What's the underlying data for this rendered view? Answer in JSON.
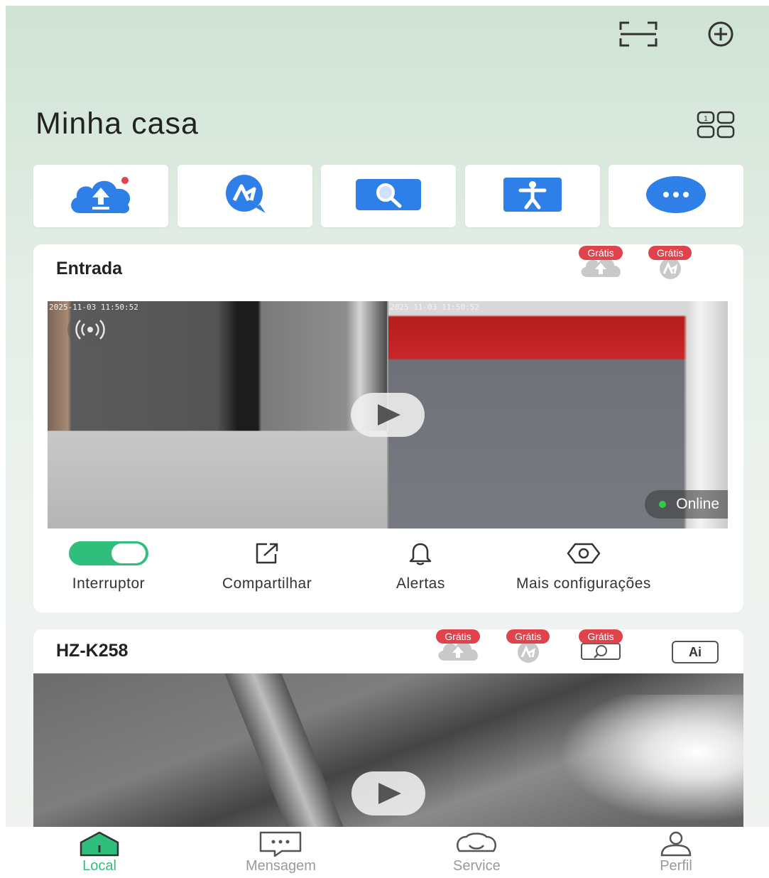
{
  "header": {
    "title": "Minha casa",
    "scan_icon": "scan-icon",
    "add_icon": "add-circle-icon",
    "layout_icon": "grid-layout-icon"
  },
  "quick_actions": [
    {
      "icon": "cloud-upload-icon"
    },
    {
      "icon": "ai-chat-icon"
    },
    {
      "icon": "search-screen-icon"
    },
    {
      "icon": "person-icon"
    },
    {
      "icon": "more-icon"
    }
  ],
  "devices": [
    {
      "name": "Entrada",
      "services": [
        {
          "badge": "Grátis",
          "icon": "cloud-upload-icon"
        },
        {
          "badge": "Grátis",
          "icon": "ai-icon"
        }
      ],
      "timestamps": [
        "2025-11-03 11:50:52",
        "2025-11-03 11:50:52"
      ],
      "status": "Online",
      "actions": {
        "switch": "Interruptor",
        "share": "Compartilhar",
        "alerts": "Alertas",
        "settings": "Mais configurações"
      }
    },
    {
      "name": "HZ-K258",
      "services": [
        {
          "badge": "Grátis",
          "icon": "cloud-upload-icon"
        },
        {
          "badge": "Grátis",
          "icon": "ai-icon"
        },
        {
          "badge": "Grátis",
          "icon": "search-icon"
        }
      ],
      "ai_label": "Ai"
    }
  ],
  "nav": {
    "local": "Local",
    "messages": "Mensagem",
    "service": "Service",
    "profile": "Perfil"
  },
  "colors": {
    "accent": "#2fbe7c",
    "badge": "#e0434b",
    "blue": "#2f7fe8"
  }
}
